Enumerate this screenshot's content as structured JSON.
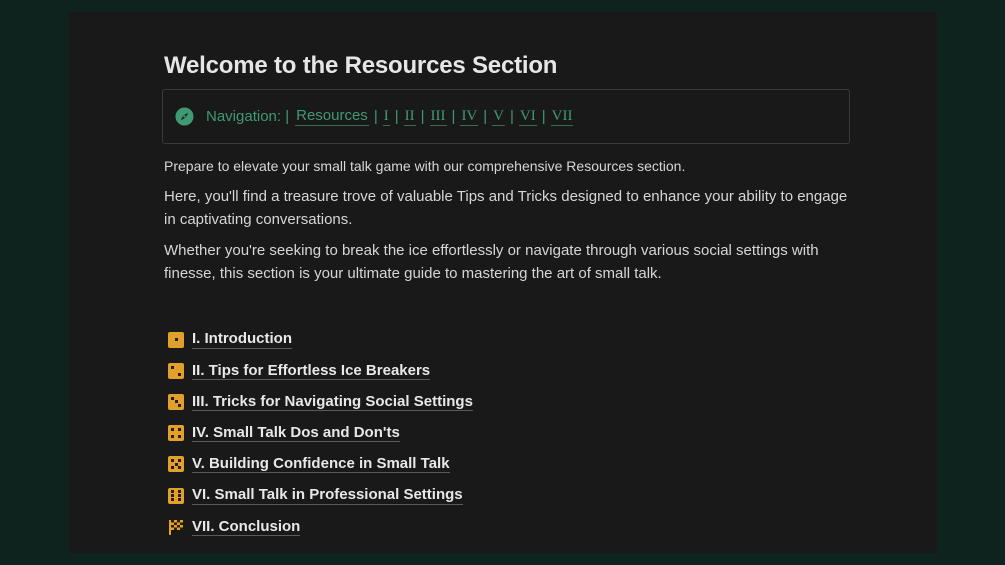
{
  "page": {
    "title": "Welcome to the Resources Section"
  },
  "navigation": {
    "label": "Navigation: |",
    "links": [
      {
        "label": "Resources"
      },
      {
        "label": "I"
      },
      {
        "label": "II"
      },
      {
        "label": "III"
      },
      {
        "label": "IV"
      },
      {
        "label": "V"
      },
      {
        "label": "VI"
      },
      {
        "label": "VII"
      }
    ],
    "separator": "|",
    "icon": "compass-icon"
  },
  "intro": {
    "p1": "Prepare to elevate your small talk game with our comprehensive Resources section.",
    "p2": "Here, you'll find a treasure trove of valuable Tips and Tricks designed to enhance your ability to engage in captivating conversations.",
    "p3": "Whether you're seeking to break the ice effortlessly or navigate through various social settings with finesse, this section is your ultimate guide to mastering the art of small talk."
  },
  "toc": [
    {
      "label": "I. Introduction",
      "icon": "die-one-icon"
    },
    {
      "label": "II. Tips for Effortless Ice Breakers",
      "icon": "die-two-icon"
    },
    {
      "label": "III. Tricks for Navigating Social Settings",
      "icon": "die-three-icon"
    },
    {
      "label": "IV. Small Talk Dos and Don'ts",
      "icon": "die-four-icon"
    },
    {
      "label": "V. Building Confidence in Small Talk",
      "icon": "die-five-icon"
    },
    {
      "label": "VI. Small Talk in Professional Settings",
      "icon": "die-six-icon"
    },
    {
      "label": "VII. Conclusion",
      "icon": "checkered-flag-icon"
    }
  ],
  "colors": {
    "background": "#0f231e",
    "page": "#191919",
    "accent_green": "#3f9a73",
    "die_orange": "#e0a02a",
    "text": "#d6d6d6"
  }
}
